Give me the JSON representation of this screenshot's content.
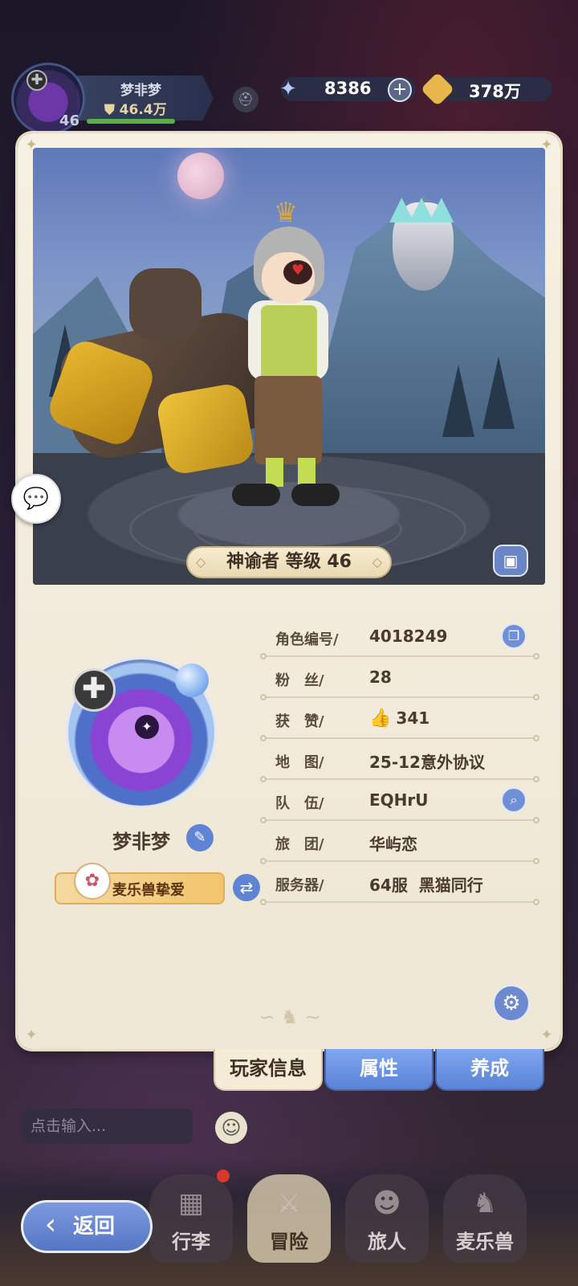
{
  "hud": {
    "player_name": "梦非梦",
    "power": "46.4万",
    "level": "46",
    "stars": "8386",
    "coins": "378万"
  },
  "scene": {
    "class_level_label": "神谕者 等级 46"
  },
  "profile": {
    "name": "梦非梦",
    "pet_tag": "麦乐兽挚爱",
    "rows": [
      {
        "label": "角色编号/",
        "value": "4018249",
        "icon": "copy-icon"
      },
      {
        "label": "粉　丝/",
        "value": "28"
      },
      {
        "label": "获　赞/",
        "value": "341",
        "icon": "thumbs-up-icon"
      },
      {
        "label": "地　图/",
        "value": "25-12意外协议"
      },
      {
        "label": "队　伍/",
        "value": "EQHrU",
        "icon": "search-icon"
      },
      {
        "label": "旅　团/",
        "value": "华屿恋"
      },
      {
        "label": "服务器/",
        "value": "64服  黑猫同行"
      }
    ]
  },
  "tabs": [
    "玩家信息",
    "属性",
    "养成"
  ],
  "chat_input_placeholder": "点击输入...",
  "nav": [
    "行李",
    "冒险",
    "旅人",
    "麦乐兽"
  ],
  "back_label": "返回",
  "colors": {
    "accent_blue": "#5f84d4",
    "card_bg": "#f6f0e2",
    "gold": "#e8b64a"
  }
}
